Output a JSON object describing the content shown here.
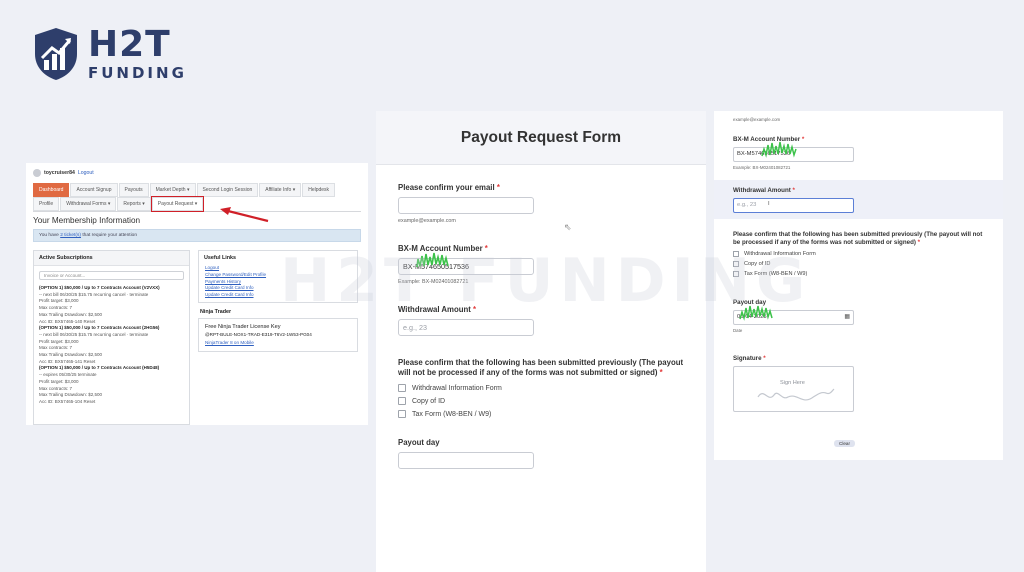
{
  "brand": {
    "name": "H2T",
    "tagline": "FUNDING",
    "watermark": "H2T FUNDING"
  },
  "membership": {
    "username": "toycruiser84",
    "logout": "Logout",
    "nav_row1": [
      "Dashboard",
      "Account Signup",
      "Payouts",
      "Market Depth ▾",
      "Second Login Session",
      "Affiliate Info ▾",
      "Helpdesk"
    ],
    "nav_row2": [
      "Profile",
      "Withdrawal Forms ▾",
      "Reports ▾",
      "Payout Request ▾"
    ],
    "title": "Your Membership Information",
    "alert_pre": "You have",
    "alert_link": "2 ticket(s)",
    "alert_post": "that require your attention",
    "active_subscriptions": {
      "title": "Active Subscriptions",
      "search_placeholder": "Invoice or Account...",
      "lines": [
        {
          "t": "(OPTION 1) $50,000 / Up to 7 Contracts Account (V2VXX)",
          "b": true
        },
        {
          "t": "-- next bill 06/30/25 $15.75 recurring cancel · terminate",
          "b": false
        },
        {
          "t": "Profit target: $3,000",
          "b": false
        },
        {
          "t": "Max contracts: 7",
          "b": false
        },
        {
          "t": "Max Trailing Drawdown: $2,500",
          "b": false
        },
        {
          "t": "Acc ID: BX57465-140 Reset",
          "b": false
        },
        {
          "t": "(OPTION 1) $50,000 / Up to 7 Contracts Account (2HG56)",
          "b": true
        },
        {
          "t": "-- next bill 06/30/25 $15.75 recurring cancel · terminate",
          "b": false
        },
        {
          "t": "Profit target: $3,000",
          "b": false
        },
        {
          "t": "Max contracts: 7",
          "b": false
        },
        {
          "t": "Max Trailing Drawdown: $2,500",
          "b": false
        },
        {
          "t": "Acc ID: BX57465-141 Reset",
          "b": false
        },
        {
          "t": "(OPTION 1) $50,000 / Up to 7 Contracts Account (H5D48)",
          "b": true
        },
        {
          "t": "-- expires 05/30/25 terminate",
          "b": false
        },
        {
          "t": "Profit target: $3,000",
          "b": false
        },
        {
          "t": "Max contracts: 7",
          "b": false
        },
        {
          "t": "Max Trailing Drawdown: $2,500",
          "b": false
        },
        {
          "t": "Acc ID: BX57465-104 Reset",
          "b": false
        }
      ]
    },
    "useful_links": {
      "title": "Useful Links",
      "items": [
        "Logout",
        "Change Password/Edit Profile",
        "Payments History",
        "Update Credit Card Info",
        "Update Credit Card Info"
      ]
    },
    "ninja": {
      "title": "Ninja Trader",
      "license_title": "Free Ninja Trader License Key",
      "license_key": "@RPT-BULE-NOX1-TRAD-E319-T6V2-1W53-PG04",
      "link": "NinjaTrader 8 on Mobile"
    }
  },
  "payout_form": {
    "title": "Payout Request Form",
    "email_label": "Please confirm your email",
    "email_hint": "example@example.com",
    "account_label": "BX-M Account Number",
    "account_value": "BX-M574650517536",
    "account_hint": "Example: BX-M02401082721",
    "withdrawal_label": "Withdrawal Amount",
    "withdrawal_placeholder": "e.g., 23",
    "confirm_label": "Please confirm that the following has been submitted previously (The payout will not be processed if any of the forms was not submitted or signed)",
    "options": [
      "Withdrawal Information Form",
      "Copy of ID",
      "Tax Form (W8-BEN / W9)"
    ],
    "payout_day_label": "Payout day"
  },
  "form_cont": {
    "email_hint": "example@example.com",
    "account_label": "BX-M Account Number",
    "account_value": "BX-M574650517536",
    "account_hint": "Example: BX-M02401082721",
    "withdrawal_label": "Withdrawal Amount",
    "withdrawal_placeholder": "e.g., 23",
    "confirm_label": "Please confirm that the following has been submitted previously (The payout will not be processed if any of the forms was not submitted or signed)",
    "options": [
      "Withdrawal Information Form",
      "Copy of ID",
      "Tax Form (W8-BEN / W9)"
    ],
    "payout_day_label": "Payout day",
    "payout_day_value": "06-04-2025",
    "date_hint": "Date",
    "signature_label": "Signature",
    "signature_placeholder": "Sign Here",
    "clear_label": "Clear"
  },
  "colors": {
    "brand": "#2e3e6b",
    "active_tab": "#e06a42",
    "highlight": "#d02028",
    "required": "#e23b3b",
    "focus": "#5c7fd6",
    "scribble": "#3cc24a"
  }
}
